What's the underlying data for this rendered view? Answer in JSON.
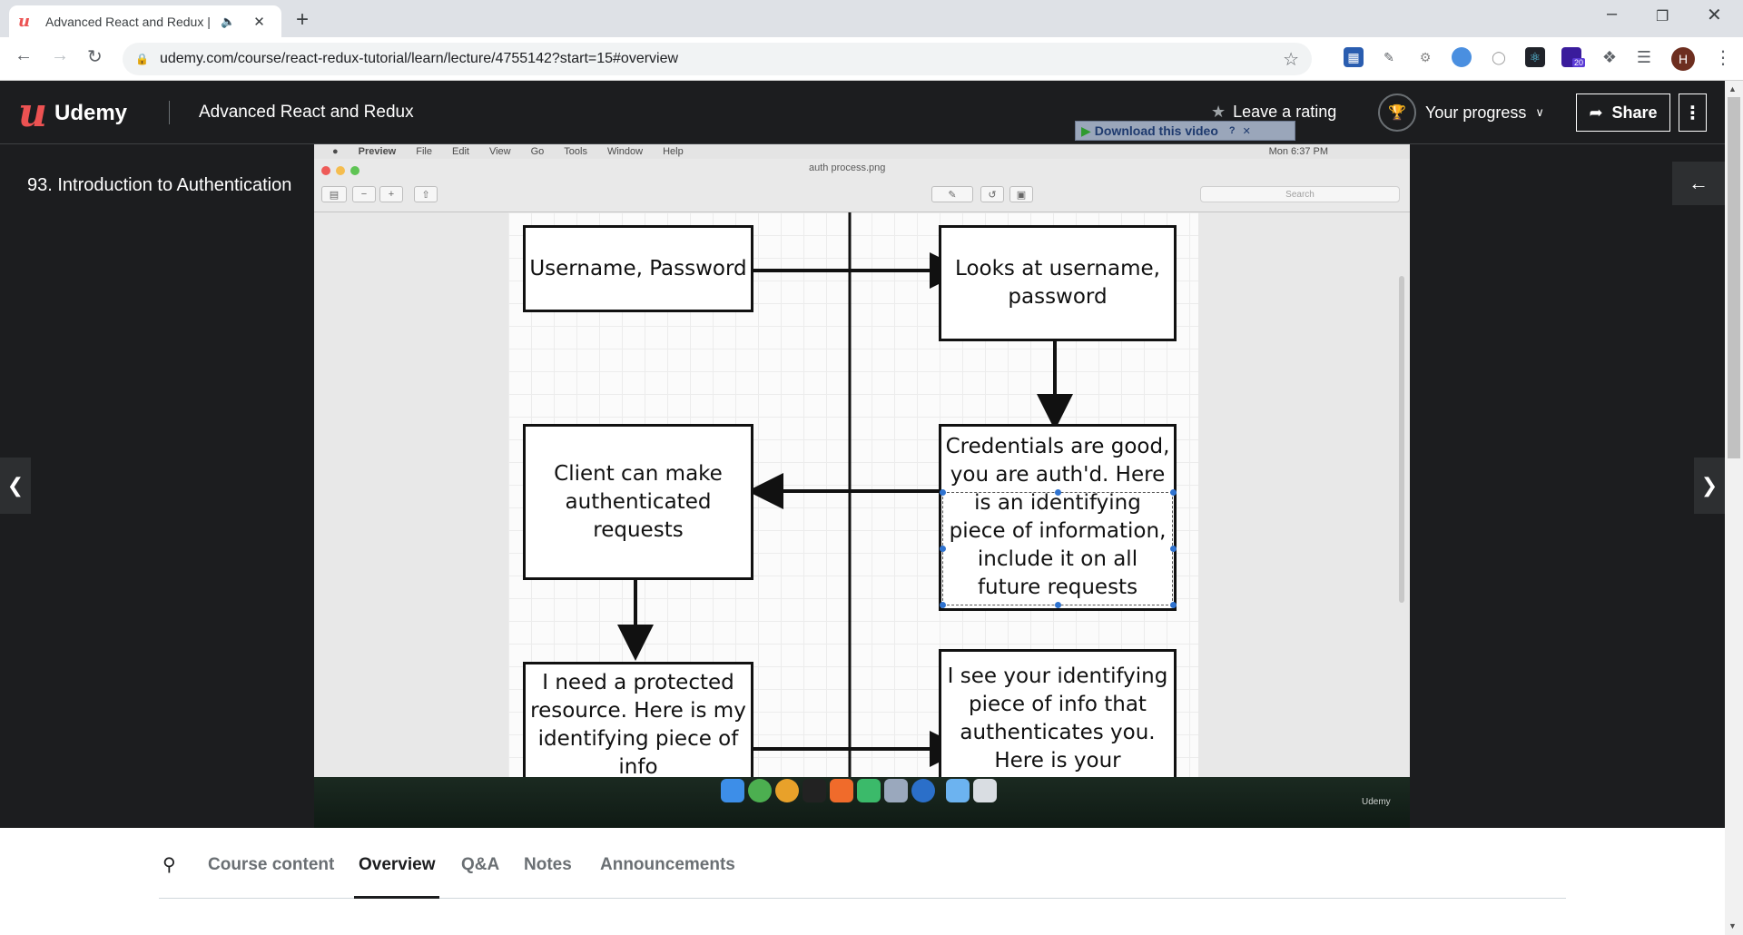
{
  "browser": {
    "tab_title": "Advanced React and Redux |",
    "url": "udemy.com/course/react-redux-tutorial/learn/lecture/4755142?start=15#overview",
    "extension_badge": "20",
    "profile_initial": "H"
  },
  "header": {
    "logo_text": "Udemy",
    "course_title": "Advanced React and Redux",
    "leave_rating": "Leave a rating",
    "your_progress": "Your progress",
    "share": "Share"
  },
  "player": {
    "lecture_title": "93. Introduction to Authentication",
    "download_label": "Download this video",
    "mac_menu": [
      "Preview",
      "File",
      "Edit",
      "View",
      "Go",
      "Tools",
      "Window",
      "Help"
    ],
    "mac_clock": "Mon 6:37 PM",
    "file_name": "auth process.png",
    "search_placeholder": "Search",
    "watermark": "Udemy"
  },
  "diagram": {
    "boxes": {
      "username_password": "Username, Password",
      "looks_at": "Looks at username, password",
      "client_can": "Client can make authenticated requests",
      "credentials_good": "Credentials are good, you are auth'd. Here is an identifying piece of information, include it on all future requests",
      "need_protected": "I need a protected resource. Here is my identifying piece of info",
      "see_your": "I see your identifying piece of info that authenticates you. Here is your"
    }
  },
  "tabs": [
    {
      "label": "Course content"
    },
    {
      "label": "Overview"
    },
    {
      "label": "Q&A"
    },
    {
      "label": "Notes"
    },
    {
      "label": "Announcements"
    }
  ],
  "colors": {
    "brand": "#ec5252",
    "header_bg": "#1c1d1f",
    "selection_handle": "#2f73d0"
  }
}
